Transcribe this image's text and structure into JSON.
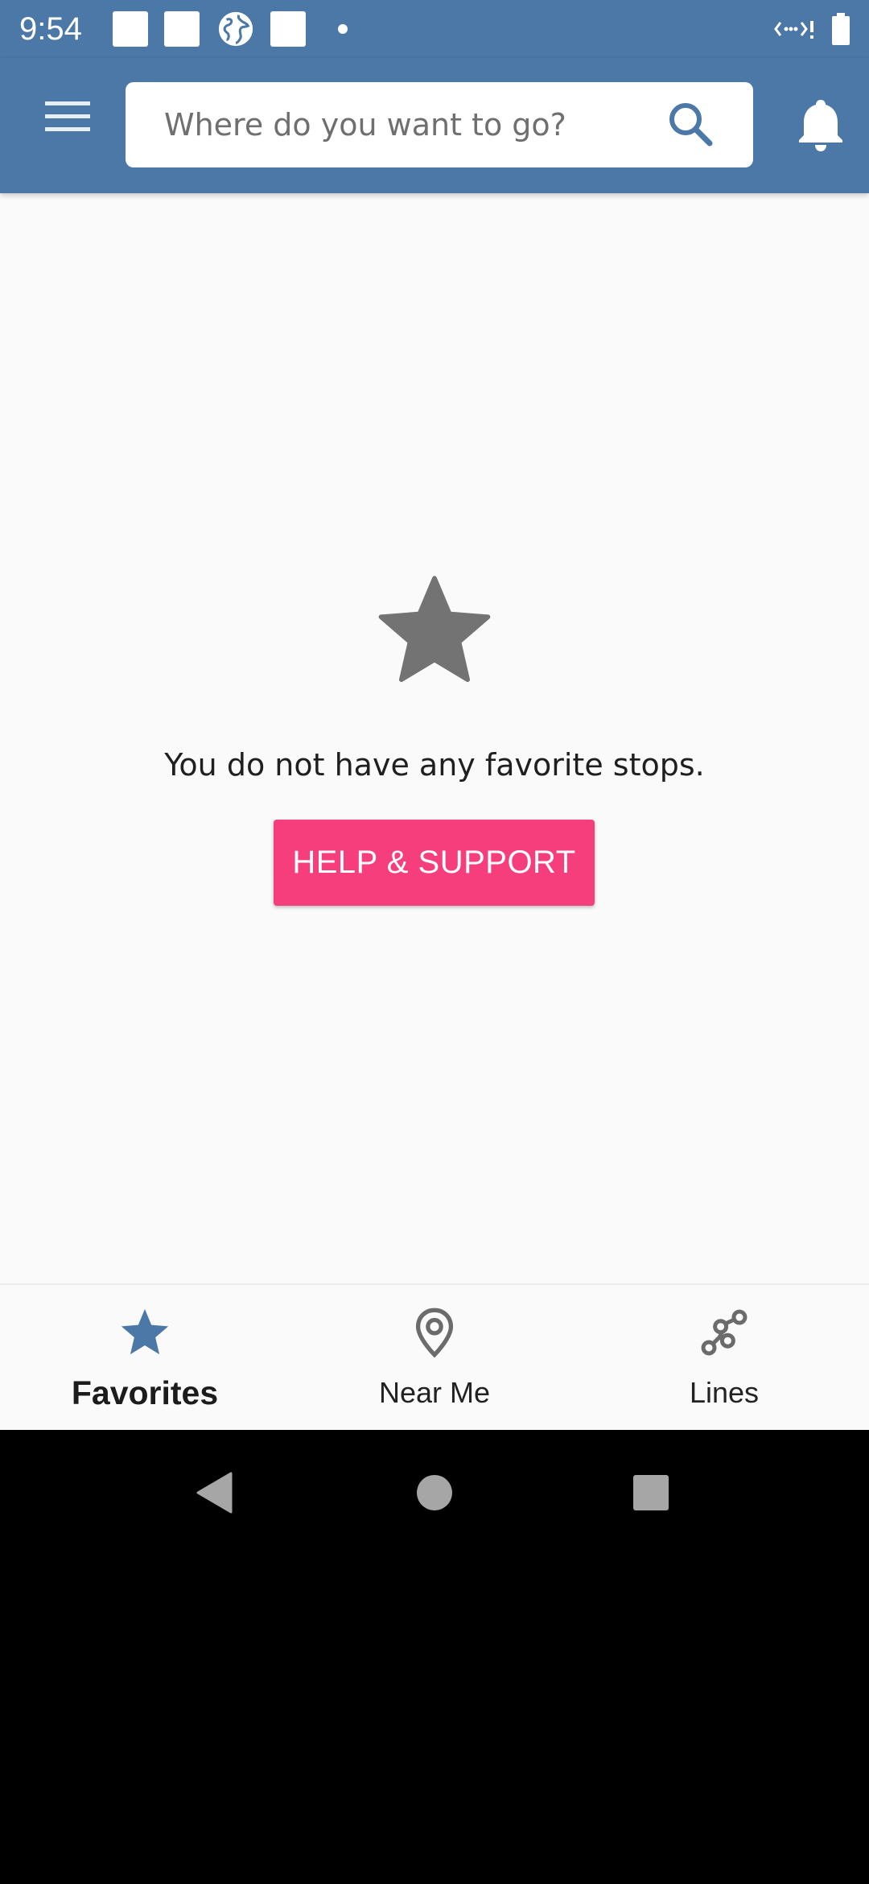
{
  "status_bar": {
    "time": "9:54",
    "background_color": "#4b78a6"
  },
  "app_bar": {
    "menu_icon": "hamburger-menu-icon",
    "search": {
      "placeholder": "Where do you want to go?",
      "value": "",
      "icon": "search-icon"
    },
    "bell_icon": "bell-icon",
    "background_color": "#4b78a6"
  },
  "empty_state": {
    "icon": "star-icon",
    "message": "You do not have any favorite stops.",
    "help_button_label": "HELP & SUPPORT",
    "help_button_color": "#f73e7d"
  },
  "bottom_nav": {
    "items": [
      {
        "label": "Favorites",
        "icon": "star-icon",
        "active": true
      },
      {
        "label": "Near Me",
        "icon": "location-pin-icon",
        "active": false
      },
      {
        "label": "Lines",
        "icon": "route-lines-icon",
        "active": false
      }
    ],
    "active_color": "#4b78a6"
  },
  "system_nav": {
    "back_icon": "back-triangle-icon",
    "home_icon": "home-circle-icon",
    "recents_icon": "recents-square-icon"
  }
}
